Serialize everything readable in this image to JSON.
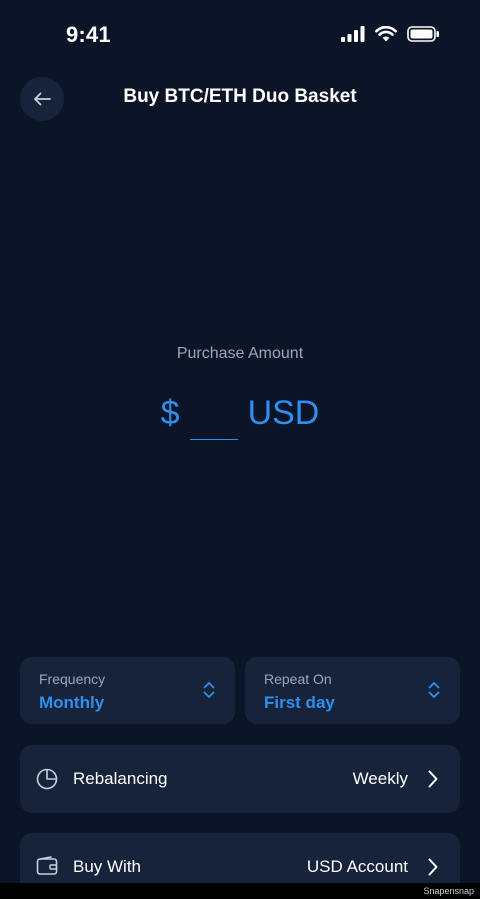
{
  "status_bar": {
    "time": "9:41"
  },
  "header": {
    "title": "Buy BTC/ETH Duo Basket"
  },
  "amount": {
    "label": "Purchase Amount",
    "currency_symbol": "$",
    "value": "",
    "currency_code": "USD"
  },
  "frequency": {
    "label": "Frequency",
    "value": "Monthly"
  },
  "repeat_on": {
    "label": "Repeat On",
    "value": "First day"
  },
  "rebalancing": {
    "label": "Rebalancing",
    "value": "Weekly",
    "icon": "pie-chart-icon"
  },
  "buy_with": {
    "label": "Buy With",
    "value": "USD Account",
    "icon": "wallet-icon"
  },
  "watermark": "Snapensnap",
  "colors": {
    "background": "#0c1527",
    "card": "#17233a",
    "accent": "#2d8ff0",
    "muted": "#9aa6bb"
  }
}
